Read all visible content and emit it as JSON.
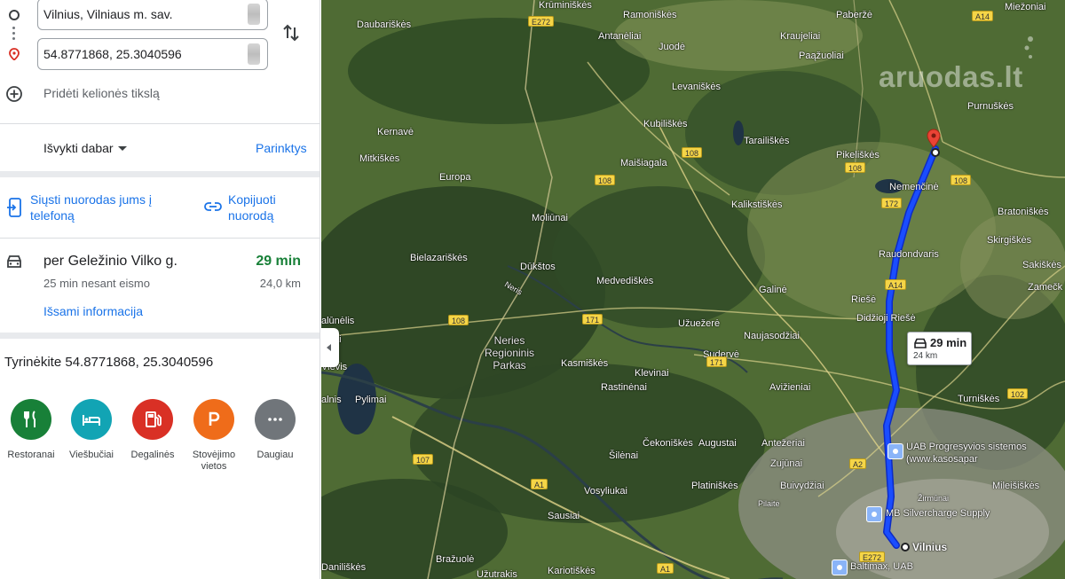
{
  "directions": {
    "origin_value": "Vilnius, Vilniaus m. sav.",
    "destination_value": "54.8771868, 25.3040596",
    "add_destination_label": "Pridėti kelionės tikslą"
  },
  "options_bar": {
    "depart_label": "Išvykti dabar",
    "options_label": "Parinktys"
  },
  "share": {
    "send_to_phone_label": "Siųsti nuorodas jums į telefoną",
    "copy_link_label": "Kopijuoti nuorodą"
  },
  "route": {
    "via": "per Geležinio Vilko g.",
    "duration": "29 min",
    "without_traffic": "25 min nesant eismo",
    "distance": "24,0 km",
    "details_label": "Išsami informacija"
  },
  "explore": {
    "title": "Tyrinėkite 54.8771868, 25.3040596",
    "categories": [
      {
        "label": "Restoranai",
        "icon": "fork-knife-icon",
        "color": "#188038"
      },
      {
        "label": "Viešbučiai",
        "icon": "bed-icon",
        "color": "#12a4b4"
      },
      {
        "label": "Degalinės",
        "icon": "fuel-pump-icon",
        "color": "#d93025"
      },
      {
        "label": "Stovėjimo vietos",
        "icon": "parking-icon",
        "color": "#ef6c1a"
      },
      {
        "label": "Daugiau",
        "icon": "more-icon",
        "color": "#70757a"
      }
    ]
  },
  "map": {
    "watermark": "aruodas.lt",
    "route_bubble": {
      "duration": "29 min",
      "distance": "24 km"
    },
    "route_color": "#1a4dff",
    "places": [
      "Krūminiškės",
      "Ramoniškės",
      "Paberžė",
      "Miežoniai",
      "Daubariškės",
      "Antanėliai",
      "Juodė",
      "Kraujeliai",
      "Paąžuoliai",
      "Levaniškės",
      "Purnuškės",
      "Kubiliškės",
      "Kernavė",
      "Tarailiškės",
      "Mitkiškės",
      "Maišiagala",
      "Pikeliškės",
      "Europa",
      "Nemenčinė",
      "Kalikstiškės",
      "Bratoniškės",
      "Moliūnai",
      "Skirgiškės",
      "Bielazariškės",
      "Dūkštos",
      "Raudondvaris",
      "Sakiškės",
      "Medvediškės",
      "Zamečk",
      "Galinė",
      "Riešė",
      "Didžioji Riešė",
      "Užuežerė",
      "Naujasodžiai",
      "Neries Regioninis Parkas",
      "Kasmiškės",
      "Sudervė",
      "Klevinai",
      "Rastinėnai",
      "Avižieniai",
      "Turniškės",
      "Pylimai",
      "Čekoniškės",
      "Augustai",
      "Antežeriai",
      "Šilėnai",
      "Zujūnai",
      "Platiniškės",
      "Buivydžiai",
      "Vosyliukai",
      "Sausiai",
      "Pilaitė",
      "Žirmūnai",
      "Mileišiškės",
      "Vilnius",
      "Daniliškės",
      "Bražuolė",
      "Kariotiškės",
      "Užutrakis",
      "alūnėlis",
      "inkai",
      "Vievis",
      "alnis",
      "Neris"
    ],
    "road_labels": [
      "E272",
      "A14",
      "108",
      "172",
      "171",
      "102",
      "107",
      "A1",
      "A2"
    ],
    "businesses": [
      "UAB Progresyvios sistemos (www.kasosapar",
      "MB Silvercharge Supply",
      "Baltimax, UAB"
    ]
  }
}
